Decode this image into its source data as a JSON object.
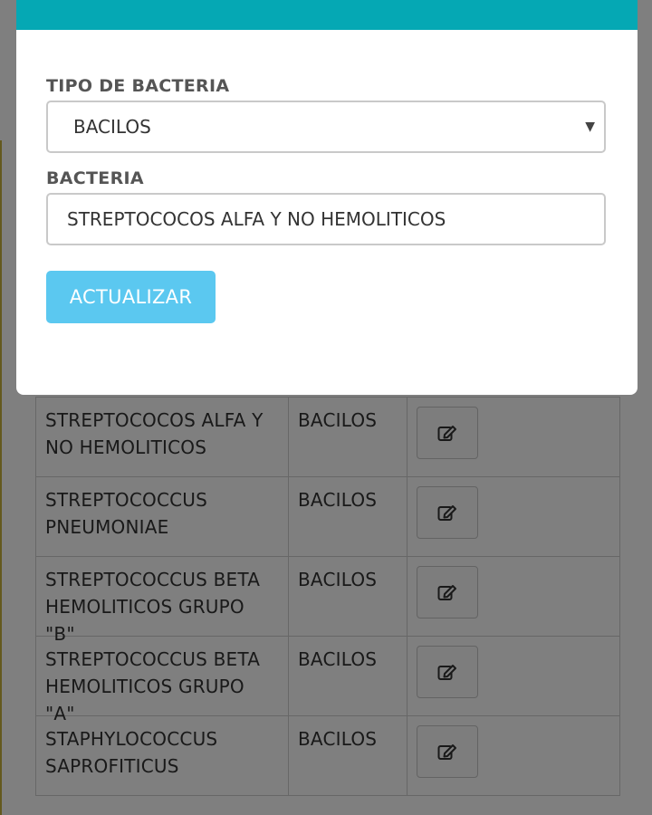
{
  "modal": {
    "type_label": "TIPO DE BACTERIA",
    "type_selected": "BACILOS",
    "bacteria_label": "BACTERIA",
    "bacteria_value": "STREPTOCOCOS ALFA Y NO HEMOLITICOS",
    "submit_label": "ACTUALIZAR",
    "header_color": "#05a8b4",
    "button_color": "#5bc8f0"
  },
  "table": {
    "rows": [
      {
        "name_line1": "STREPTOCOCOS ALFA Y",
        "name_line2": "NO HEMOLITICOS",
        "type": "BACILOS",
        "action_icon": "edit-icon"
      },
      {
        "name_line1": "STREPTOCOCCUS",
        "name_line2": "PNEUMONIAE",
        "type": "BACILOS",
        "action_icon": "edit-icon"
      },
      {
        "name_line1": "STREPTOCOCCUS BETA",
        "name_line2": "HEMOLITICOS GRUPO \"B\"",
        "type": "BACILOS",
        "action_icon": "edit-icon"
      },
      {
        "name_line1": "STREPTOCOCCUS BETA",
        "name_line2": "HEMOLITICOS GRUPO \"A\"",
        "type": "BACILOS",
        "action_icon": "edit-icon"
      },
      {
        "name_line1": "STAPHYLOCOCCUS",
        "name_line2": "SAPROFITICUS",
        "type": "BACILOS",
        "action_icon": "edit-icon"
      }
    ]
  }
}
